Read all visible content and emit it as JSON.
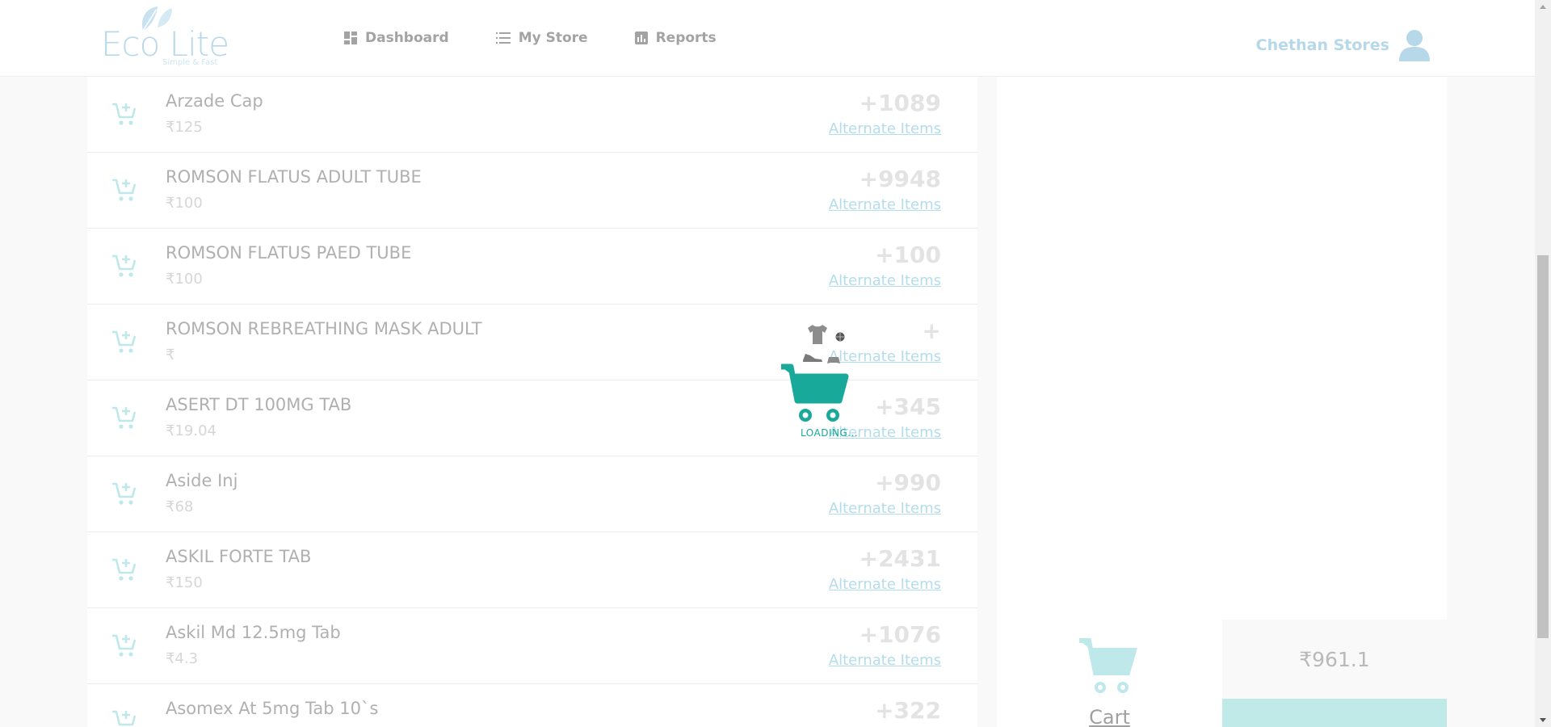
{
  "brand": {
    "name": "Eco Lite",
    "tagline": "Simple & Fast"
  },
  "nav": [
    {
      "label": "Dashboard",
      "icon": "dashboard-icon"
    },
    {
      "label": "My Store",
      "icon": "list-icon"
    },
    {
      "label": "Reports",
      "icon": "bar-chart-icon"
    }
  ],
  "user": {
    "store_name": "Chethan Stores",
    "icon": "user-icon"
  },
  "products": [
    {
      "name": "Arzade Cap",
      "price": "₹125",
      "stock": "+1089",
      "alt_label": "Alternate Items"
    },
    {
      "name": "ROMSON FLATUS ADULT TUBE",
      "price": "₹100",
      "stock": "+9948",
      "alt_label": "Alternate Items"
    },
    {
      "name": "ROMSON FLATUS PAED TUBE",
      "price": "₹100",
      "stock": "+100",
      "alt_label": "Alternate Items"
    },
    {
      "name": "ROMSON REBREATHING MASK ADULT",
      "price": "₹",
      "stock": "+",
      "alt_label": "Alternate Items"
    },
    {
      "name": "ASERT DT 100MG TAB",
      "price": "₹19.04",
      "stock": "+345",
      "alt_label": "Alternate Items"
    },
    {
      "name": "Aside Inj",
      "price": "₹68",
      "stock": "+990",
      "alt_label": "Alternate Items"
    },
    {
      "name": "ASKIL FORTE TAB",
      "price": "₹150",
      "stock": "+2431",
      "alt_label": "Alternate Items"
    },
    {
      "name": "Askil Md 12.5mg Tab",
      "price": "₹4.3",
      "stock": "+1076",
      "alt_label": "Alternate Items"
    },
    {
      "name": "Asomex At 5mg Tab 10`s",
      "price": "",
      "stock": "+322",
      "alt_label": ""
    }
  ],
  "cart": {
    "label": "Cart",
    "total": "₹961.1"
  },
  "loader": {
    "text": "LOADING..."
  },
  "colors": {
    "accent": "#19a99a",
    "brand_light": "#b9d9ea",
    "cart_icon": "#bfe8ea",
    "checkout_bar": "#bfeae8"
  }
}
